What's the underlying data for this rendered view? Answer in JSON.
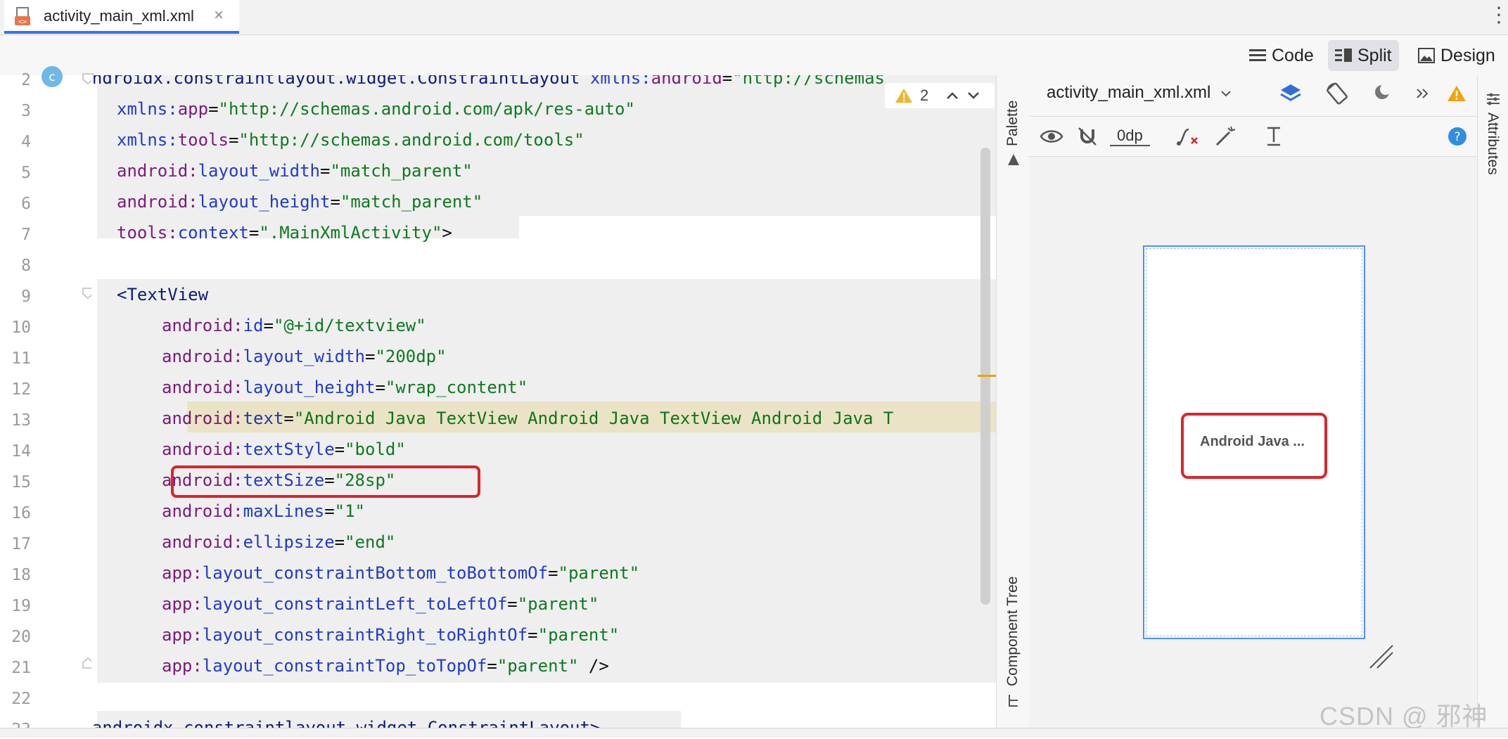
{
  "tab": {
    "label": "activity_main_xml.xml",
    "close": "×"
  },
  "menu": {
    "more": "⋮"
  },
  "modes": {
    "code": "Code",
    "split": "Split",
    "design": "Design"
  },
  "editor": {
    "warning_count": "2",
    "lines": [
      {
        "n": "2",
        "parts": [
          [
            "tag",
            "<androidx.constraintlayout.widget.ConstraintLayout "
          ],
          [
            "attr",
            "xmlns:"
          ],
          [
            "ns",
            "android"
          ],
          [
            "punc",
            "="
          ],
          [
            "str",
            "\"http://schemas"
          ]
        ]
      },
      {
        "n": "3",
        "parts": [
          [
            "attr",
            "xmlns:"
          ],
          [
            "ns",
            "app"
          ],
          [
            "punc",
            "="
          ],
          [
            "str",
            "\"http://schemas.android.com/apk/res-auto\""
          ]
        ]
      },
      {
        "n": "4",
        "parts": [
          [
            "attr",
            "xmlns:"
          ],
          [
            "ns",
            "tools"
          ],
          [
            "punc",
            "="
          ],
          [
            "str",
            "\"http://schemas.android.com/tools\""
          ]
        ]
      },
      {
        "n": "5",
        "parts": [
          [
            "ns",
            "android:"
          ],
          [
            "attr",
            "layout_width"
          ],
          [
            "punc",
            "="
          ],
          [
            "str",
            "\"match_parent\""
          ]
        ]
      },
      {
        "n": "6",
        "parts": [
          [
            "ns",
            "android:"
          ],
          [
            "attr",
            "layout_height"
          ],
          [
            "punc",
            "="
          ],
          [
            "str",
            "\"match_parent\""
          ]
        ]
      },
      {
        "n": "7",
        "parts": [
          [
            "ns",
            "tools:"
          ],
          [
            "attr",
            "context"
          ],
          [
            "punc",
            "="
          ],
          [
            "str",
            "\".MainXmlActivity\""
          ],
          [
            "punc",
            ">"
          ]
        ]
      },
      {
        "n": "8",
        "parts": []
      },
      {
        "n": "9",
        "parts": [
          [
            "tag",
            "<TextView"
          ]
        ]
      },
      {
        "n": "10",
        "parts": [
          [
            "ns",
            "android:"
          ],
          [
            "attr",
            "id"
          ],
          [
            "punc",
            "="
          ],
          [
            "str",
            "\"@+id/textview\""
          ]
        ]
      },
      {
        "n": "11",
        "parts": [
          [
            "ns",
            "android:"
          ],
          [
            "attr",
            "layout_width"
          ],
          [
            "punc",
            "="
          ],
          [
            "str",
            "\"200dp\""
          ]
        ]
      },
      {
        "n": "12",
        "parts": [
          [
            "ns",
            "android:"
          ],
          [
            "attr",
            "layout_height"
          ],
          [
            "punc",
            "="
          ],
          [
            "str",
            "\"wrap_content\""
          ]
        ]
      },
      {
        "n": "13",
        "parts": [
          [
            "ns",
            "android:"
          ],
          [
            "attr",
            "text"
          ],
          [
            "punc",
            "="
          ],
          [
            "str",
            "\"Android Java TextView Android Java TextView Android Java T"
          ]
        ]
      },
      {
        "n": "14",
        "parts": [
          [
            "ns",
            "android:"
          ],
          [
            "attr",
            "textStyle"
          ],
          [
            "punc",
            "="
          ],
          [
            "str",
            "\"bold\""
          ]
        ]
      },
      {
        "n": "15",
        "parts": [
          [
            "ns",
            "android:"
          ],
          [
            "attr",
            "textSize"
          ],
          [
            "punc",
            "="
          ],
          [
            "str",
            "\"28sp\""
          ]
        ]
      },
      {
        "n": "16",
        "parts": [
          [
            "ns",
            "android:"
          ],
          [
            "attr",
            "maxLines"
          ],
          [
            "punc",
            "="
          ],
          [
            "str",
            "\"1\""
          ]
        ]
      },
      {
        "n": "17",
        "parts": [
          [
            "ns",
            "android:"
          ],
          [
            "attr",
            "ellipsize"
          ],
          [
            "punc",
            "="
          ],
          [
            "str",
            "\"end\""
          ]
        ]
      },
      {
        "n": "18",
        "parts": [
          [
            "ns",
            "app:"
          ],
          [
            "attr",
            "layout_constraintBottom_toBottomOf"
          ],
          [
            "punc",
            "="
          ],
          [
            "str",
            "\"parent\""
          ]
        ]
      },
      {
        "n": "19",
        "parts": [
          [
            "ns",
            "app:"
          ],
          [
            "attr",
            "layout_constraintLeft_toLeftOf"
          ],
          [
            "punc",
            "="
          ],
          [
            "str",
            "\"parent\""
          ]
        ]
      },
      {
        "n": "20",
        "parts": [
          [
            "ns",
            "app:"
          ],
          [
            "attr",
            "layout_constraintRight_toRightOf"
          ],
          [
            "punc",
            "="
          ],
          [
            "str",
            "\"parent\""
          ]
        ]
      },
      {
        "n": "21",
        "parts": [
          [
            "ns",
            "app:"
          ],
          [
            "attr",
            "layout_constraintTop_toTopOf"
          ],
          [
            "punc",
            "="
          ],
          [
            "str",
            "\"parent\""
          ],
          [
            "punc",
            " />"
          ]
        ]
      },
      {
        "n": "22",
        "parts": []
      },
      {
        "n": "23",
        "parts": [
          [
            "tag",
            "</androidx.constraintlayout.widget.ConstraintLayout>"
          ]
        ]
      }
    ]
  },
  "side": {
    "palette": "Palette",
    "component_tree": "Component Tree",
    "attributes": "Attributes"
  },
  "design": {
    "file": "activity_main_xml.xml",
    "margin": "0dp",
    "preview_text": "Android Java ..."
  },
  "watermark": "CSDN @ 邪神",
  "colors": {
    "accent": "#3574f0",
    "highlight": "#d9262b",
    "warning": "#e0a800"
  }
}
